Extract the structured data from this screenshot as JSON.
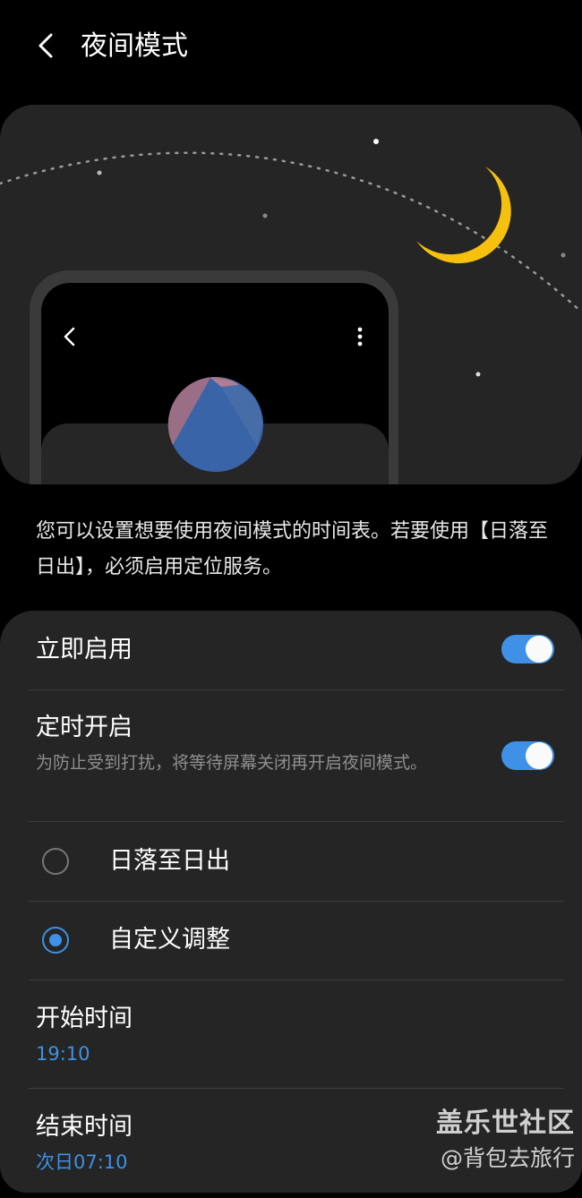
{
  "header": {
    "title": "夜间模式"
  },
  "description": "您可以设置想要使用夜间模式的时间表。若要使用【日落至日出】，必须启用定位服务。",
  "settings": {
    "enable_now": {
      "label": "立即启用",
      "enabled": true
    },
    "scheduled": {
      "label": "定时开启",
      "sub": "为防止受到打扰，将等待屏幕关闭再开启夜间模式。",
      "enabled": true
    },
    "options": [
      {
        "label": "日落至日出",
        "selected": false
      },
      {
        "label": "自定义调整",
        "selected": true
      }
    ],
    "start_time": {
      "label": "开始时间",
      "value": "19:10"
    },
    "end_time": {
      "label": "结束时间",
      "value": "次日07:10"
    }
  },
  "watermark": {
    "line1": "盖乐世社区",
    "line2": "@背包去旅行"
  },
  "colors": {
    "accent": "#3e91e6",
    "card": "#252525",
    "moon": "#f6c10e"
  }
}
